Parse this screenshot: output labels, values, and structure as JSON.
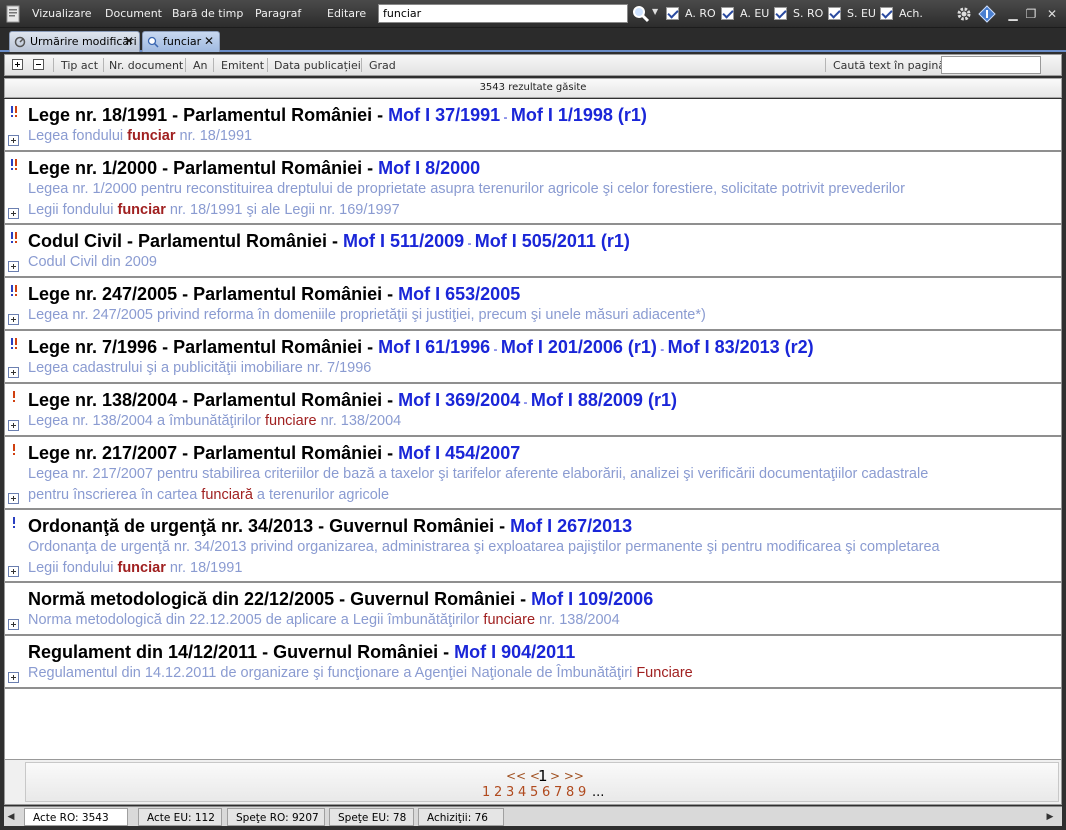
{
  "menu": {
    "items": [
      "Vizualizare",
      "Document",
      "Bară de timp",
      "Paragraf",
      "Editare"
    ],
    "search_value": "funciar",
    "filters": [
      {
        "label": "A. RO",
        "checked": true
      },
      {
        "label": "A. EU",
        "checked": true
      },
      {
        "label": "S. RO",
        "checked": true
      },
      {
        "label": "S. EU",
        "checked": true
      },
      {
        "label": "Ach.",
        "checked": true
      }
    ]
  },
  "tabs": [
    {
      "label": "Urmărire modificări",
      "active": false
    },
    {
      "label": "funciar",
      "active": true
    }
  ],
  "columns": {
    "headers": [
      "Tip act",
      "Nr. document",
      "An",
      "Emitent",
      "Data publicației",
      "Grad"
    ],
    "find_label": "Caută text în pagină"
  },
  "results_count": "3543 rezultate găsite",
  "results": [
    {
      "title": "Lege nr. 18/1991 - Parlamentul României -",
      "mof": [
        {
          "text": "Mof I 37/1991"
        },
        {
          "text": "Mof I 1/1998 (r1)"
        }
      ],
      "desc": [
        [
          "Legea fondului ",
          "funciar",
          " nr. 18/1991"
        ]
      ],
      "importance": "!!"
    },
    {
      "title": "Lege nr. 1/2000 - Parlamentul României -",
      "mof": [
        {
          "text": "Mof I 8/2000"
        }
      ],
      "desc": [
        [
          "Legea nr. 1/2000 pentru reconstituirea dreptului de proprietate asupra terenurilor agricole şi celor forestiere, solicitate potrivit prevederilor"
        ],
        [
          "Legii fondului ",
          "funciar",
          " nr. 18/1991 şi ale Legii nr. 169/1997"
        ]
      ],
      "importance": "!!"
    },
    {
      "title": "Codul Civil - Parlamentul României -",
      "mof": [
        {
          "text": "Mof I 511/2009"
        },
        {
          "text": "Mof I 505/2011 (r1)"
        }
      ],
      "desc": [
        [
          "Codul Civil din 2009"
        ]
      ],
      "importance": "!!"
    },
    {
      "title": "Lege nr. 247/2005 - Parlamentul României -",
      "mof": [
        {
          "text": "Mof I 653/2005"
        }
      ],
      "desc": [
        [
          "Legea nr. 247/2005 privind reforma în domeniile proprietăţii şi justiţiei, precum şi unele măsuri adiacente*)"
        ]
      ],
      "importance": "!!"
    },
    {
      "title": "Lege nr. 7/1996 - Parlamentul României -",
      "mof": [
        {
          "text": "Mof I 61/1996"
        },
        {
          "text": "Mof I 201/2006 (r1)"
        },
        {
          "text": "Mof I 83/2013 (r2)"
        }
      ],
      "desc": [
        [
          "Legea cadastrului şi a publicităţii imobiliare nr. 7/1996"
        ]
      ],
      "importance": "!!"
    },
    {
      "title": "Lege nr. 138/2004 - Parlamentul României -",
      "mof": [
        {
          "text": "Mof I 369/2004"
        },
        {
          "text": "Mof I 88/2009 (r1)"
        }
      ],
      "desc": [
        [
          "Legea nr. 138/2004 a îmbunătăţirilor ",
          "funciare",
          " nr. 138/2004"
        ]
      ],
      "importance": "!"
    },
    {
      "title": "Lege nr. 217/2007 - Parlamentul României -",
      "mof": [
        {
          "text": "Mof I 454/2007"
        }
      ],
      "desc": [
        [
          "Legea nr. 217/2007 pentru stabilirea criteriilor de bază a taxelor şi tarifelor aferente elaborării, analizei şi verificării documentaţiilor cadastrale"
        ],
        [
          "pentru înscrierea în cartea ",
          "funciară",
          " a terenurilor agricole"
        ]
      ],
      "importance": "!"
    },
    {
      "title": "Ordonanţă de urgenţă nr. 34/2013 - Guvernul României -",
      "mof": [
        {
          "text": "Mof I 267/2013"
        }
      ],
      "desc": [
        [
          "Ordonanţa de urgenţă nr. 34/2013 privind organizarea, administrarea şi exploatarea pajiştilor permanente şi pentru modificarea şi completarea"
        ],
        [
          "Legii fondului ",
          "funciar",
          " nr. 18/1991"
        ]
      ],
      "importance": "!b"
    },
    {
      "title": "Normă metodologică din 22/12/2005 - Guvernul României -",
      "mof": [
        {
          "text": "Mof I 109/2006"
        }
      ],
      "desc": [
        [
          "Norma metodologică din 22.12.2005 de aplicare a Legii îmbunătăţirilor ",
          "funciare",
          " nr. 138/2004"
        ]
      ],
      "importance": ""
    },
    {
      "title": "Regulament din 14/12/2011 - Guvernul României -",
      "mof": [
        {
          "text": "Mof I 904/2011"
        }
      ],
      "desc": [
        [
          "Regulamentul din 14.12.2011 de organizare şi funcţionare a Agenţiei Naţionale de Îmbunătăţiri ",
          "Funciare",
          ""
        ]
      ],
      "importance": ""
    }
  ],
  "pager": {
    "first_prev": "<< <",
    "current": "1",
    "next_last": "> >>",
    "pages": [
      "1",
      "2",
      "3",
      "4",
      "5",
      "6",
      "7",
      "8",
      "9"
    ],
    "more": "..."
  },
  "bottom_tabs": [
    {
      "label": "Acte RO: 3543",
      "active": true
    },
    {
      "label": "Acte EU: 112",
      "active": false
    },
    {
      "label": "Speţe RO: 9207",
      "active": false
    },
    {
      "label": "Speţe EU: 78",
      "active": false
    },
    {
      "label": "Achiziţii: 76",
      "active": false
    }
  ],
  "colors": {
    "title_link": "#1a26d8",
    "highlight": "#a02020",
    "desc": "#8a9bd1"
  }
}
